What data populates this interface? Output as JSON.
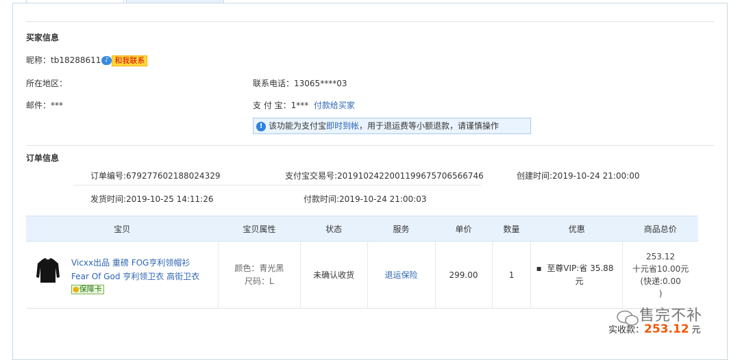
{
  "buyer": {
    "section_title": "买家信息",
    "nickname_label": "昵称：",
    "nickname": "tb18288611",
    "wangwang_icon_text": "♪",
    "contact_button": "和我联系",
    "region_label": "所在地区：",
    "phone_label": "联系电话：",
    "phone": "13065****03",
    "email_label": "邮件：",
    "email": "***",
    "alipay_label": "支 付 宝：",
    "alipay": "1***",
    "pay_buyer_link": "付款给买家",
    "notice_pre": "该功能为支付宝",
    "notice_link": "即时到帐",
    "notice_post": "，用于退运费等小额退款，请谨慎操作"
  },
  "order": {
    "section_title": "订单信息",
    "order_no_label": "订单编号:",
    "order_no": "679277602188024329",
    "alipay_trade_label": "支付宝交易号:",
    "alipay_trade_no": "2019102422001199675706566746",
    "created_label": "创建时间:",
    "created": "2019-10-24 21:00:00",
    "shipped_label": "发货时间:",
    "shipped": "2019-10-25 14:11:26",
    "paid_time_label": "付款时间:",
    "paid_time": "2019-10-24 21:00:03"
  },
  "table": {
    "headers": [
      "宝贝",
      "宝贝属性",
      "状态",
      "服务",
      "单价",
      "数量",
      "优惠",
      "商品总价"
    ],
    "row": {
      "title_line1": "Vicxx出品 重磅 FOG亨利领帽衫",
      "title_line2": "Fear Of God 亨利领卫衣 高街卫衣",
      "guarantee_tag": "保障卡",
      "color": "颜色：青光黑",
      "size": "尺码：L",
      "status": "未确认收货",
      "service": "退运保险",
      "price": "299.00",
      "quantity": "1",
      "discount_line1": "至尊VIP:省 35.88",
      "discount_line2": "元",
      "total_line1": "253.12",
      "total_line2": "十元省10.00元",
      "total_line3": "(快递:0.00",
      "total_line4": ")"
    }
  },
  "paid": {
    "label": "实收款：",
    "amount": "253.12",
    "unit": "元"
  },
  "watermark": "售完不补",
  "colors": {
    "link": "#2d64b3",
    "accent": "#f25807",
    "header_bg": "#e8f2fc",
    "notice_bg": "#eaf4fe"
  }
}
